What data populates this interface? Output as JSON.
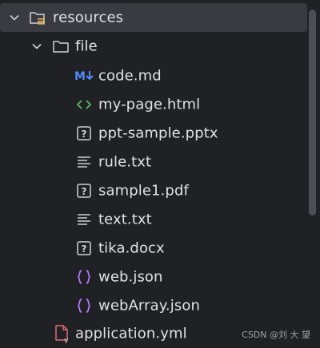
{
  "tree": {
    "root": {
      "label": "resources",
      "icon": "resources-folder-icon",
      "expanded": true
    },
    "folder": {
      "label": "file",
      "icon": "folder-icon",
      "expanded": true
    },
    "files": [
      {
        "label": "code.md",
        "icon": "markdown-icon"
      },
      {
        "label": "my-page.html",
        "icon": "html-icon"
      },
      {
        "label": "ppt-sample.pptx",
        "icon": "unknown-file-icon"
      },
      {
        "label": "rule.txt",
        "icon": "text-file-icon"
      },
      {
        "label": "sample1.pdf",
        "icon": "unknown-file-icon"
      },
      {
        "label": "text.txt",
        "icon": "text-file-icon"
      },
      {
        "label": "tika.docx",
        "icon": "unknown-file-icon"
      },
      {
        "label": "web.json",
        "icon": "json-icon"
      },
      {
        "label": "webArray.json",
        "icon": "json-icon"
      }
    ],
    "config": {
      "label": "application.yml",
      "icon": "yaml-icon"
    }
  },
  "watermark": "CSDN @刘 大 望",
  "colors": {
    "background": "#1f2124",
    "selected_row": "#393b40",
    "text": "#dfe1e5",
    "markdown_blue": "#548af7",
    "html_green": "#5fb865",
    "json_purple": "#b57bff",
    "yaml_red": "#e06c75",
    "scrollbar": "#4c4f55"
  }
}
